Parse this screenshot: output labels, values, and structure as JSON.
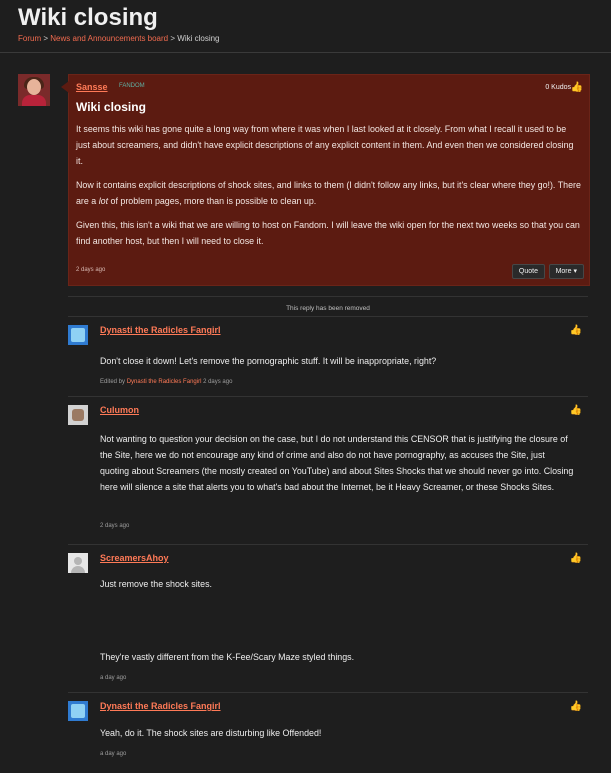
{
  "header": {
    "title": "Wiki closing",
    "breadcrumb": {
      "forum": "Forum",
      "separator1": ">",
      "board": "News and Announcements board",
      "separator2": ">",
      "current": "Wiki closing"
    }
  },
  "original_post": {
    "author": "Sansse",
    "badge": "FANDOM",
    "kudos": "0 Kudos",
    "title": "Wiki closing",
    "paragraph1": "It seems this wiki has gone quite a long way from where it was when I last looked at it closely. From what I recall it used to be just about screamers, and didn't have explicit descriptions of any explicit content in them. And even then we considered closing it.",
    "paragraph2_before": "Now it contains explicit descriptions of shock sites, and links to them (I didn't follow any links, but it's clear where they go!). There are a ",
    "paragraph2_em": "lot",
    "paragraph2_after": " of problem pages, more than is possible to clean up.",
    "paragraph3": "Given this, this isn't a wiki that we are willing to host on Fandom. I will leave the wiki open for the next two weeks so that you can find another host, but then I will need to close it.",
    "date": "2 days ago",
    "quote_label": "Quote",
    "more_label": "More ▾"
  },
  "removed_notice": "This reply has been removed",
  "replies": [
    {
      "author": "Dynasti the Radicles Fangirl",
      "text": "Don't close it down! Let's remove the pornographic stuff. It will be inappropriate, right?",
      "edited_prefix": "Edited by",
      "edited_by": "Dynasti the Radicles Fangirl",
      "date": "2 days ago"
    },
    {
      "author": "Culumon",
      "text": "Not wanting to question your decision on the case, but I do not understand this CENSOR that is justifying the closure of the Site, here we do not encourage any kind of crime and also do not have pornography, as accuses the Site, just quoting about Screamers (the mostly created on YouTube) and about Sites Shocks that we should never go into. Closing here will silence a site that alerts you to what's bad about the Internet, be it Heavy Screamer, or these Shocks Sites.",
      "date": "2 days ago"
    },
    {
      "author": "ScreamersAhoy",
      "text1": "Just remove the shock sites.",
      "text2": "They're vastly different from the K-Fee/Scary Maze styled things.",
      "date": "a day ago"
    },
    {
      "author": "Dynasti the Radicles Fangirl",
      "text": "Yeah, do it. The shock sites are disturbing like Offended!",
      "date": "a day ago"
    }
  ],
  "icons": {
    "kudos": "thumbs-up-icon",
    "fandom": "fandom-logo-icon"
  },
  "colors": {
    "background": "#1e1e1e",
    "op_background": "#5c1b11",
    "accent": "#ff7a57"
  }
}
